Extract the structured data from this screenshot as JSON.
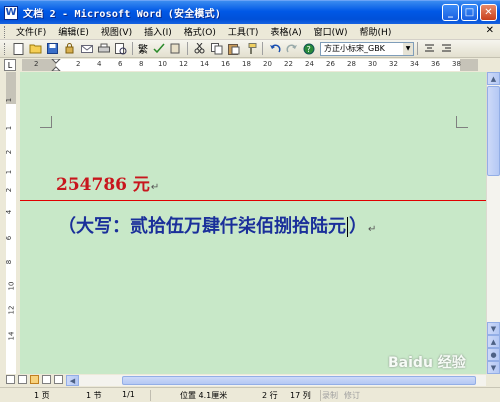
{
  "window": {
    "title": "文档 2 - Microsoft Word (安全模式)",
    "app_icon": "W",
    "minimize": "_",
    "maximize": "□",
    "close": "✕"
  },
  "menu": {
    "items": [
      "文件(F)",
      "编辑(E)",
      "视图(V)",
      "插入(I)",
      "格式(O)",
      "工具(T)",
      "表格(A)",
      "窗口(W)",
      "帮助(H)"
    ],
    "close_doc": "✕"
  },
  "toolbar": {
    "new_icon": "new-document-icon",
    "trad_simp": "繁",
    "font_name": "方正小标宋_GBK",
    "icons": [
      "open-icon",
      "save-icon",
      "permission-icon",
      "email-icon",
      "print-icon",
      "print-preview-icon",
      "spelling-icon",
      "research-icon",
      "cut-icon",
      "copy-icon",
      "paste-icon",
      "format-painter-icon",
      "undo-icon",
      "redo-icon",
      "help-icon",
      "align-center-icon",
      "align-right-icon"
    ]
  },
  "ruler": {
    "corner": "L",
    "h_numbers": [
      "2",
      "2",
      "4",
      "6",
      "8",
      "10",
      "12",
      "14",
      "16",
      "18",
      "20",
      "22",
      "24",
      "26",
      "28",
      "30",
      "32",
      "34",
      "36",
      "38"
    ],
    "v_numbers": [
      "1",
      "1",
      "2",
      "1",
      "2",
      "4",
      "6",
      "8",
      "10",
      "12",
      "14"
    ]
  },
  "document": {
    "amount_text": "254786 元",
    "paragraph_mark": "↵",
    "words_before_caret": "（大写：贰拾伍万肆仟柒佰捌拾陆元",
    "words_after_caret": "）"
  },
  "status": {
    "page": "1 页",
    "section": "1 节",
    "page_of": "1/1",
    "position": "位置 4.1厘米",
    "line": "2 行",
    "column": "17 列",
    "record": "录制",
    "revise": "修订"
  },
  "watermark": "Baidu 经验",
  "colors": {
    "doc_background": "#c8e8c8",
    "amount": "#c8161d",
    "words": "#1a2f9a",
    "rule_line": "#e00000"
  }
}
